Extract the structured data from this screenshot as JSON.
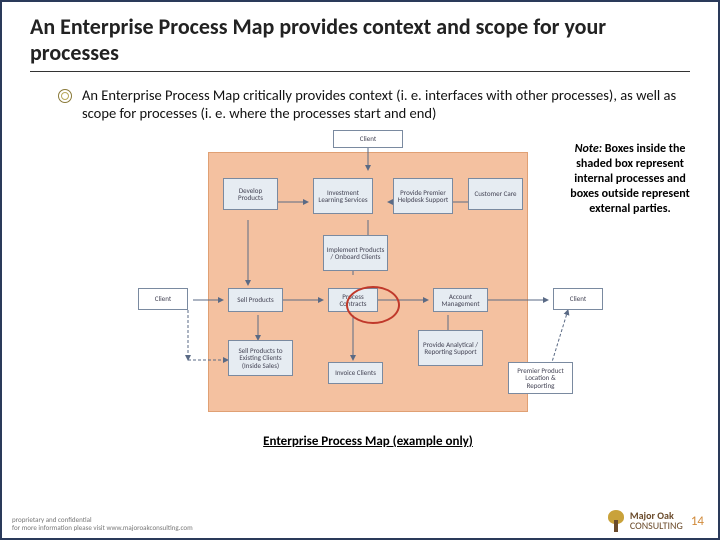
{
  "title": "An Enterprise Process Map provides context and scope for your processes",
  "bullet": "An Enterprise Process Map critically provides context (i. e. interfaces with other processes), as well as scope for processes (i. e. where the processes start and end)",
  "note_label": "Note:",
  "note_text": " Boxes inside the shaded box represent internal processes and boxes outside represent external parties.",
  "caption": "Enterprise Process Map (example only)",
  "boxes": {
    "client_top": "Client",
    "develop_products": "Develop Products",
    "investment_learning": "Investment Learning Services",
    "provide_premier": "Provide Premier Helpdesk Support",
    "customer_care": "Customer Care",
    "implement_products": "Implement Products / Onboard Clients",
    "client_left": "Client",
    "sell_products": "Sell Products",
    "process_contracts": "Process Contracts",
    "account_mgmt": "Account Management",
    "client_right": "Client",
    "sell_existing": "Sell Products to Existing Clients (Inside Sales)",
    "analytical_reporting": "Provide Analytical / Reporting Support",
    "invoice_clients": "Invoice Clients",
    "premier_loyalty": "Premier Product Location & Reporting"
  },
  "footer": {
    "line1": "proprietary and confidential",
    "line2": "for more information please visit www.majoroakconsulting.com",
    "logo_top": "Major Oak",
    "logo_bottom": "CONSULTING",
    "page": "14"
  }
}
